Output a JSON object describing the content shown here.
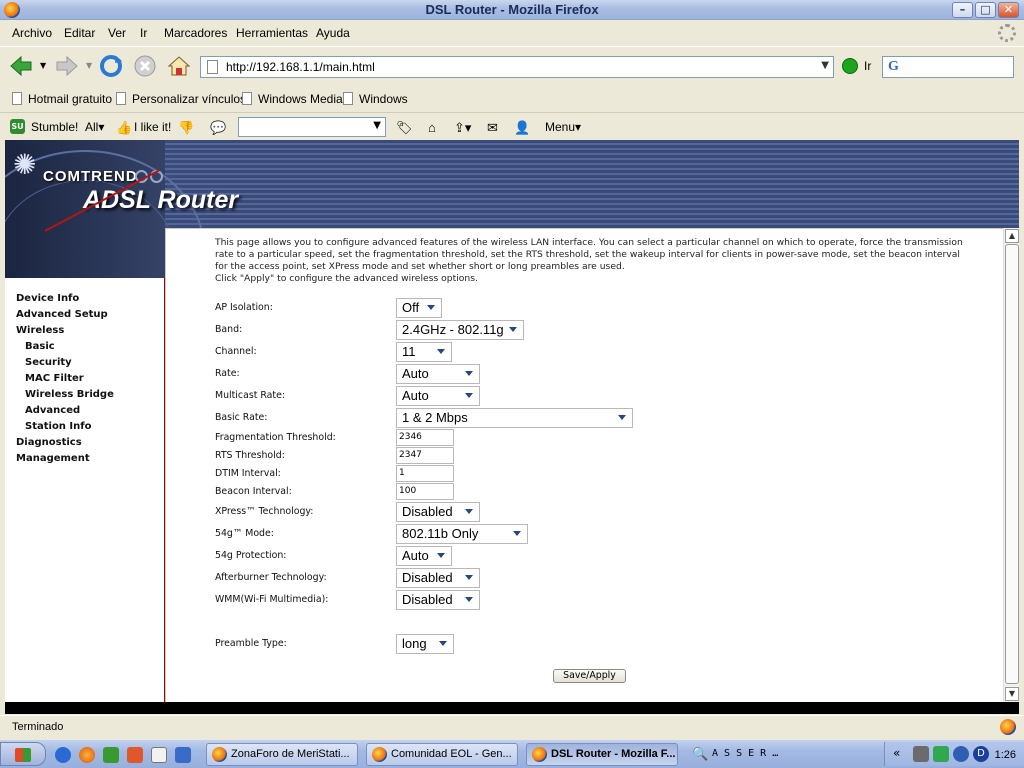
{
  "window": {
    "title": "DSL Router - Mozilla Firefox",
    "min": "–",
    "max": "□",
    "close": "✕"
  },
  "menubar": [
    "Archivo",
    "Editar",
    "Ver",
    "Ir",
    "Marcadores",
    "Herramientas",
    "Ayuda"
  ],
  "navbar": {
    "url": "http://192.168.1.1/main.html",
    "go_label": "Ir"
  },
  "bookmarks": [
    "Hotmail gratuito",
    "Personalizar vínculos",
    "Windows Media",
    "Windows"
  ],
  "stumble": {
    "stumble_label": "Stumble!",
    "all_label": "All▾",
    "like_label": "I like it!",
    "menu_label": "Menu▾"
  },
  "banner": {
    "brand": "COMTREND",
    "product": "ADSL Router"
  },
  "sidebar": {
    "items": [
      {
        "label": "Device Info",
        "sub": false
      },
      {
        "label": "Advanced Setup",
        "sub": false
      },
      {
        "label": "Wireless",
        "sub": false
      },
      {
        "label": "Basic",
        "sub": true
      },
      {
        "label": "Security",
        "sub": true
      },
      {
        "label": "MAC Filter",
        "sub": true
      },
      {
        "label": "Wireless Bridge",
        "sub": true
      },
      {
        "label": "Advanced",
        "sub": true
      },
      {
        "label": "Station Info",
        "sub": true
      },
      {
        "label": "Diagnostics",
        "sub": false
      },
      {
        "label": "Management",
        "sub": false
      }
    ]
  },
  "main": {
    "intro": "This page allows you to configure advanced features of the wireless LAN interface. You can select a particular channel on which to operate, force the transmission rate to a particular speed, set the fragmentation threshold, set the RTS threshold, set the wakeup interval for clients in power-save mode, set the beacon interval for the access point, set XPress mode and set whether short or long preambles are used.",
    "intro2": "Click \"Apply\" to configure the advanced wireless options.",
    "fields": {
      "ap_isolation": {
        "label": "AP Isolation:",
        "value": "Off"
      },
      "band": {
        "label": "Band:",
        "value": "2.4GHz - 802.11g"
      },
      "channel": {
        "label": "Channel:",
        "value": "11"
      },
      "rate": {
        "label": "Rate:",
        "value": "Auto"
      },
      "multicast_rate": {
        "label": "Multicast Rate:",
        "value": "Auto"
      },
      "basic_rate": {
        "label": "Basic Rate:",
        "value": "1 & 2 Mbps"
      },
      "frag": {
        "label": "Fragmentation Threshold:",
        "value": "2346"
      },
      "rts": {
        "label": "RTS Threshold:",
        "value": "2347"
      },
      "dtim": {
        "label": "DTIM Interval:",
        "value": "1"
      },
      "beacon": {
        "label": "Beacon Interval:",
        "value": "100"
      },
      "xpress": {
        "label": "XPress™ Technology:",
        "value": "Disabled"
      },
      "mode54g": {
        "label": "54g™ Mode:",
        "value": "802.11b Only"
      },
      "prot54g": {
        "label": "54g Protection:",
        "value": "Auto"
      },
      "afterburner": {
        "label": "Afterburner Technology:",
        "value": "Disabled"
      },
      "wmm": {
        "label": "WMM(Wi-Fi Multimedia):",
        "value": "Disabled"
      },
      "preamble": {
        "label": "Preamble Type:",
        "value": "long"
      }
    },
    "apply_label": "Save/Apply"
  },
  "status": {
    "text": "Terminado"
  },
  "taskbar": {
    "tasks": [
      {
        "label": "ZonaForo de MeriStati...",
        "active": false
      },
      {
        "label": "Comunidad EOL - Gen...",
        "active": false
      },
      {
        "label": "DSL Router - Mozilla F...",
        "active": true
      }
    ],
    "tray_glyphs": "A  S  S  E  R  …",
    "clock": "1:26"
  }
}
